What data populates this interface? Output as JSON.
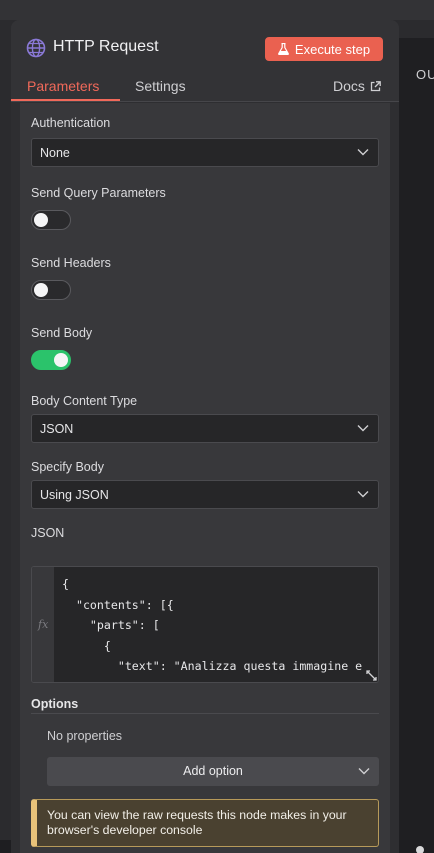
{
  "background": {
    "output_label": "OU"
  },
  "node": {
    "title": "HTTP Request",
    "execute_label": "Execute step",
    "accent_color": "#ea6150",
    "icon": "globe-icon"
  },
  "tabs": [
    {
      "label": "Parameters",
      "active": true
    },
    {
      "label": "Settings",
      "active": false
    },
    {
      "label": "Docs",
      "active": false,
      "icon": "external-link-icon"
    }
  ],
  "fields": {
    "authentication": {
      "label": "Authentication",
      "value": "None"
    },
    "send_query": {
      "label": "Send Query Parameters",
      "on": false
    },
    "send_headers": {
      "label": "Send Headers",
      "on": false
    },
    "send_body": {
      "label": "Send Body",
      "on": true,
      "color": "#2bc36b"
    },
    "body_content_type": {
      "label": "Body Content Type",
      "value": "JSON"
    },
    "specify_body": {
      "label": "Specify Body",
      "value": "Using JSON"
    },
    "json": {
      "label": "JSON",
      "expression_marker": "fx",
      "code": "{\n  \"contents\": [{\n    \"parts\": [\n      {\n        \"text\": \"Analizza questa immagine e\n classificala in una delle seguenti catego"
    }
  },
  "options": {
    "label": "Options",
    "empty_text": "No properties",
    "add_label": "Add option"
  },
  "notice": {
    "text": "You can view the raw requests this node makes in your browser's developer console"
  }
}
